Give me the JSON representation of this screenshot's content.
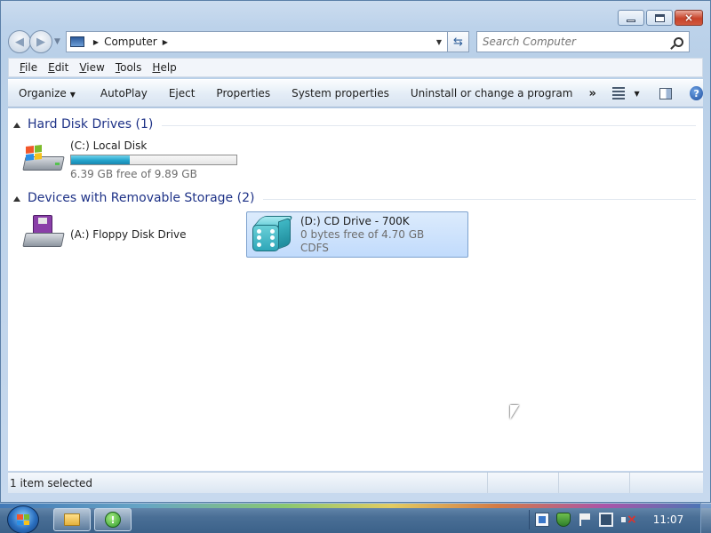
{
  "window": {
    "buttons": {
      "minimize": "minimize",
      "maximize": "maximize",
      "close": "×"
    }
  },
  "navigation": {
    "address_path": [
      "Computer"
    ],
    "search_placeholder": "Search Computer"
  },
  "menu": {
    "items": [
      {
        "accel": "F",
        "rest": "ile"
      },
      {
        "accel": "E",
        "rest": "dit"
      },
      {
        "accel": "V",
        "rest": "iew"
      },
      {
        "accel": "T",
        "rest": "ools"
      },
      {
        "accel": "H",
        "rest": "elp"
      }
    ]
  },
  "toolbar": {
    "organize": "Organize",
    "autoplay": "AutoPlay",
    "eject": "Eject",
    "properties": "Properties",
    "system_properties": "System properties",
    "uninstall": "Uninstall or change a program",
    "more": "»"
  },
  "groups": {
    "hard_disk": {
      "title": "Hard Disk Drives (1)",
      "drives": [
        {
          "name": "(C:) Local Disk",
          "free_text": "6.39 GB free of 9.89 GB",
          "used_fraction": 0.354,
          "icon": "hard-disk-windows-icon"
        }
      ]
    },
    "removable": {
      "title": "Devices with Removable Storage (2)",
      "drives": [
        {
          "name": "(A:) Floppy Disk Drive",
          "icon": "floppy-drive-icon"
        },
        {
          "name": "(D:) CD Drive - 700K",
          "free_text": "0 bytes free of 4.70 GB",
          "filesystem": "CDFS",
          "selected": true,
          "icon": "dice-cd-icon"
        }
      ]
    }
  },
  "status": {
    "text": "1 item selected"
  },
  "taskbar": {
    "clock": "11:07",
    "pinned": [
      "folder-icon",
      "app-icon"
    ],
    "tray_icons": [
      "document-icon",
      "shield-icon",
      "flag-icon",
      "network-icon",
      "volume-muted-icon"
    ]
  },
  "colors": {
    "group_title": "#1e3287",
    "selection": "#c1dbfc",
    "usage_bar": "#25a4cc"
  }
}
